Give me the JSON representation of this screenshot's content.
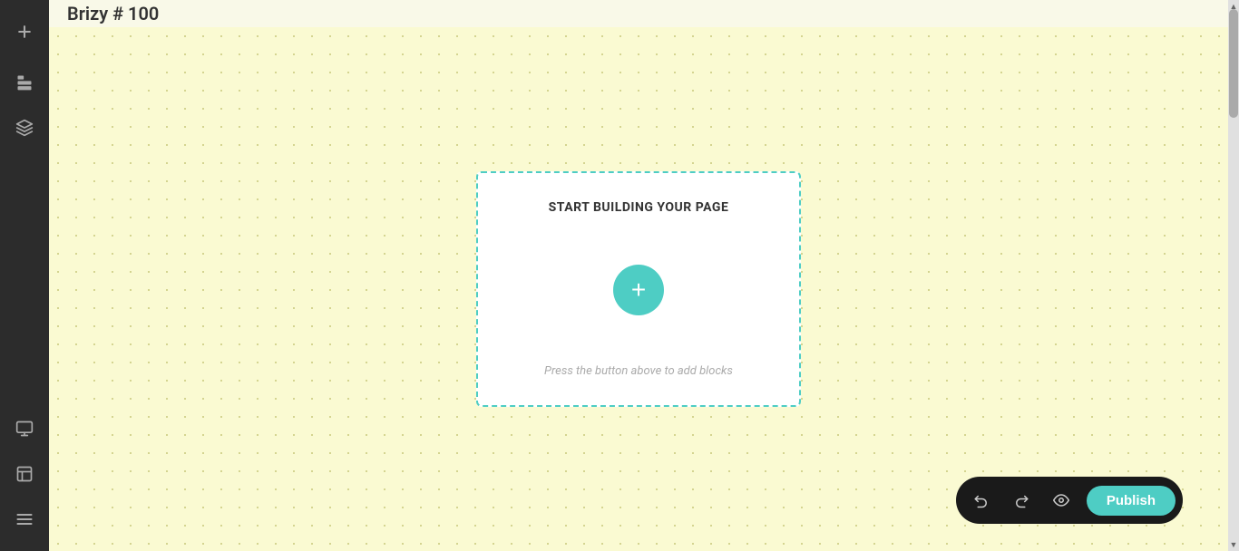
{
  "page": {
    "title": "Brizy # 100"
  },
  "sidebar": {
    "items": [
      {
        "id": "add",
        "icon": "plus-icon",
        "label": "Add"
      },
      {
        "id": "blocks",
        "icon": "blocks-icon",
        "label": "Blocks"
      },
      {
        "id": "layers",
        "icon": "layers-icon",
        "label": "Layers"
      },
      {
        "id": "monitor",
        "icon": "monitor-icon",
        "label": "Preview"
      },
      {
        "id": "template",
        "icon": "template-icon",
        "label": "Template"
      },
      {
        "id": "menu",
        "icon": "menu-icon",
        "label": "Menu"
      }
    ]
  },
  "canvas": {
    "start_card": {
      "title": "START BUILDING YOUR PAGE",
      "hint": "Press the button above to add blocks",
      "add_button_label": "+"
    }
  },
  "toolbar": {
    "undo_label": "Undo",
    "redo_label": "Redo",
    "preview_label": "Preview",
    "publish_label": "Publish"
  }
}
